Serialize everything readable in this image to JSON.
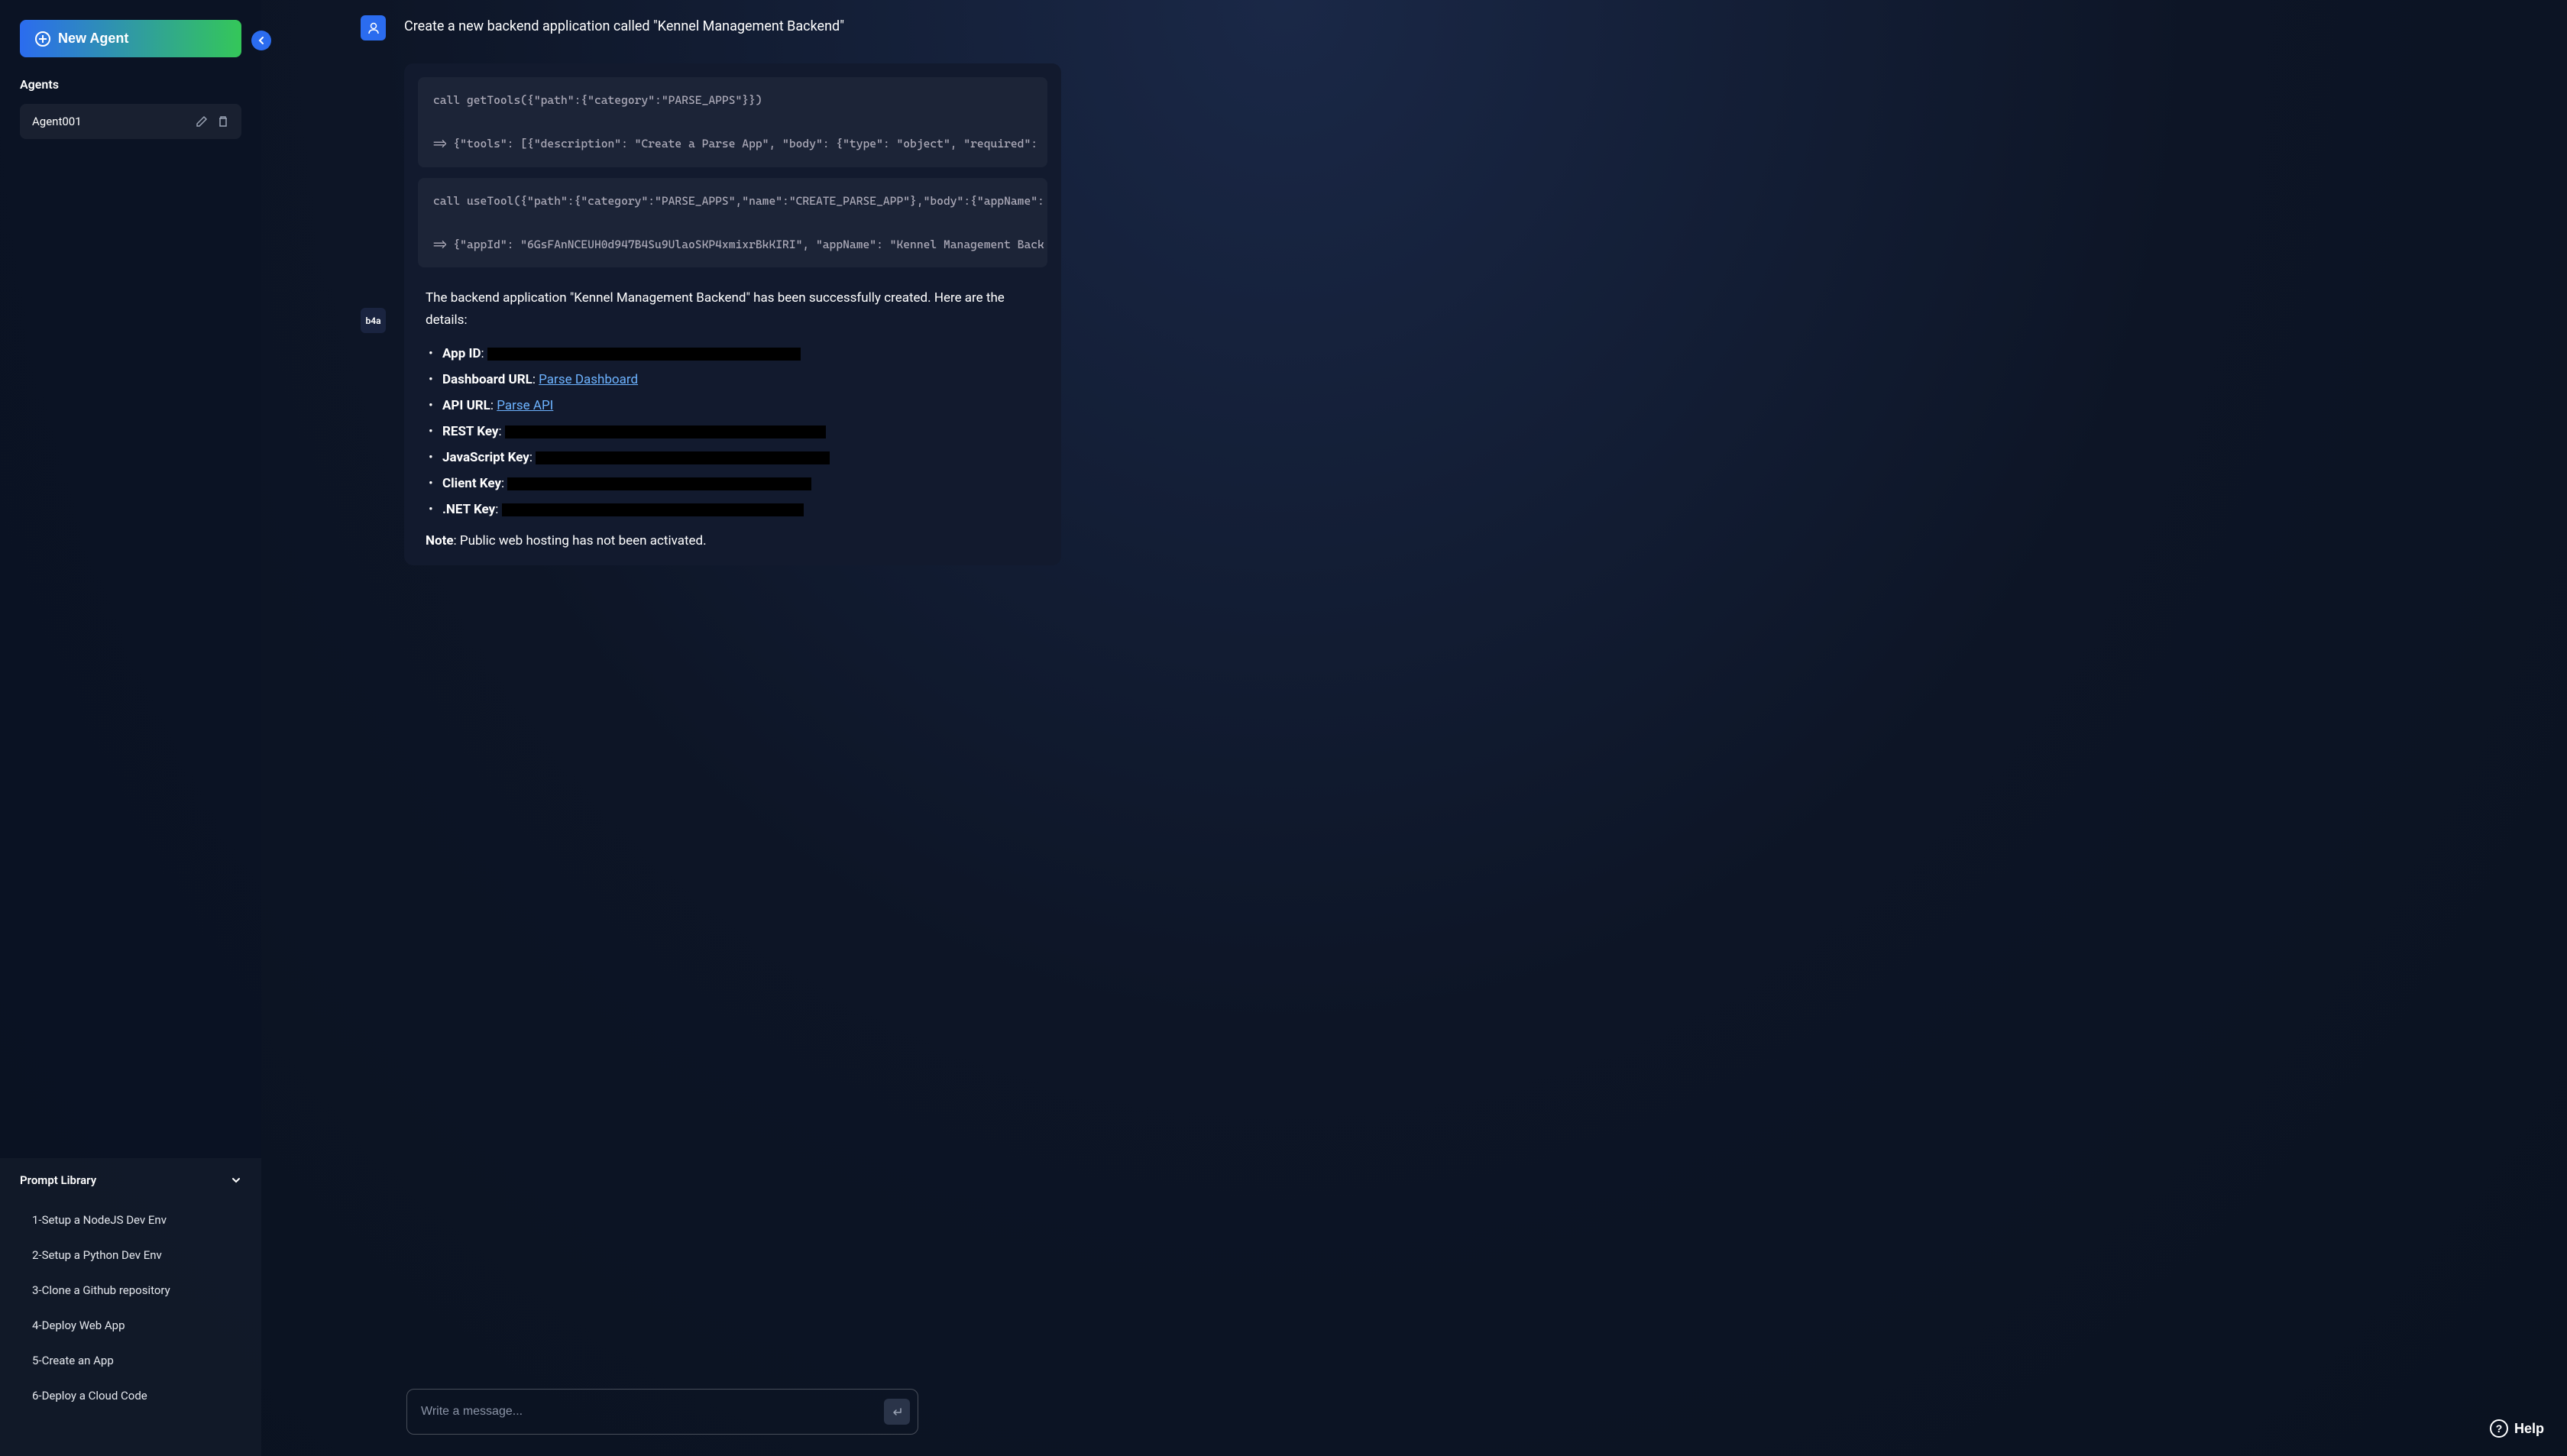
{
  "sidebar": {
    "new_agent_label": "New Agent",
    "agents_title": "Agents",
    "agent_items": [
      {
        "name": "Agent001"
      }
    ],
    "prompt_library_title": "Prompt Library",
    "prompts": [
      {
        "label": "1-Setup a NodeJS Dev Env"
      },
      {
        "label": "2-Setup a Python Dev Env"
      },
      {
        "label": "3-Clone a Github repository"
      },
      {
        "label": "4-Deploy Web App"
      },
      {
        "label": "5-Create an App"
      },
      {
        "label": "6-Deploy a Cloud Code"
      }
    ]
  },
  "chat": {
    "user_message": "Create a new backend application called \"Kennel Management Backend\"",
    "assistant_avatar_text": "b4a",
    "code_block_1": "call getTools({\"path\":{\"category\":\"PARSE_APPS\"}})\n\n=> {\"tools\": [{\"description\": \"Create a Parse App\", \"body\": {\"type\": \"object\", \"required\":",
    "code_block_2": "call useTool({\"path\":{\"category\":\"PARSE_APPS\",\"name\":\"CREATE_PARSE_APP\"},\"body\":{\"appName\":\n\n=> {\"appId\": \"6GsFAnNCEUH0d947B4Su9UlaoSKP4xmixrBkKIRI\", \"appName\": \"Kennel Management Back",
    "response_intro": "The backend application \"Kennel Management Backend\" has been successfully created. Here are the details:",
    "details": {
      "app_id_label": "App ID",
      "dashboard_url_label": "Dashboard URL",
      "dashboard_url_link": "Parse Dashboard",
      "api_url_label": "API URL",
      "api_url_link": "Parse API",
      "rest_key_label": "REST Key",
      "js_key_label": "JavaScript Key",
      "client_key_label": "Client Key",
      "dotnet_key_label": ".NET Key"
    },
    "note_label": "Note",
    "note_text": ": Public web hosting has not been activated."
  },
  "input": {
    "placeholder": "Write a message..."
  },
  "help_label": "Help"
}
